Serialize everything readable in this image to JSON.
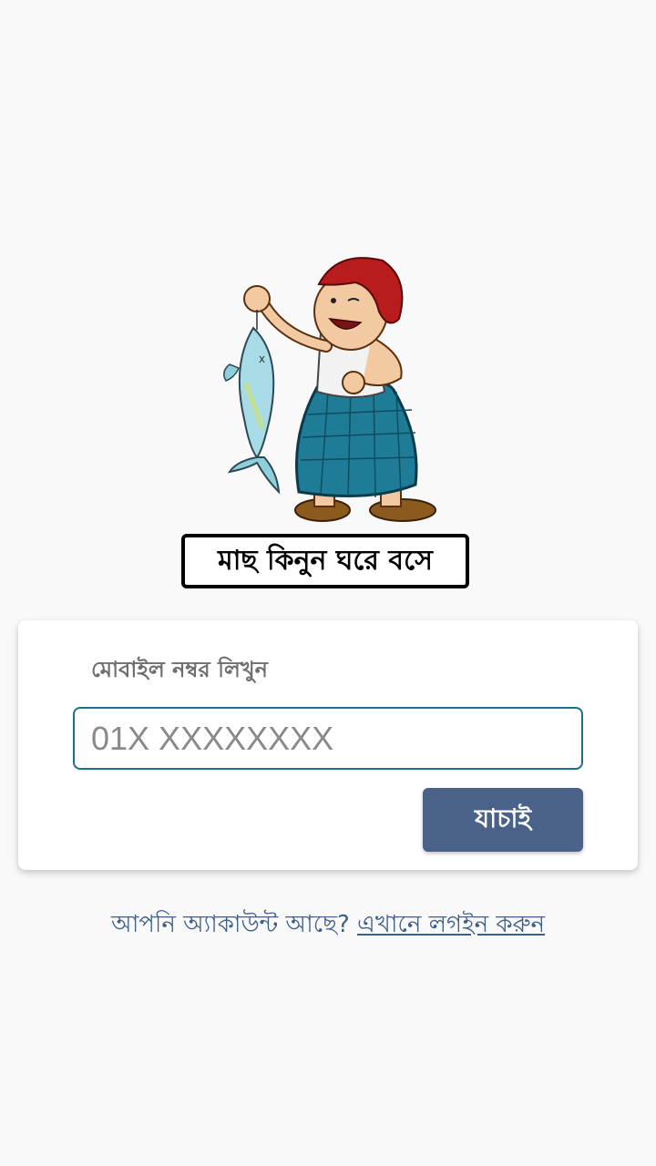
{
  "brand": {
    "tagline": "মাছ কিনুন ঘরে বসে",
    "illustration_icon": "fish-seller-boy-icon"
  },
  "form": {
    "label": "মোবাইল নম্বর লিখুন",
    "phone_placeholder": "01X XXXXXXXX",
    "phone_value": "",
    "verify_label": "যাচাই"
  },
  "footer": {
    "prompt": "আপনি অ্যাকাউন্ট আছে?",
    "link": "এখানে লগইন করুন"
  },
  "colors": {
    "background": "#f9f9f9",
    "input_border": "#1f6f86",
    "button_bg": "#4a6289",
    "link": "#3e5f8a"
  }
}
